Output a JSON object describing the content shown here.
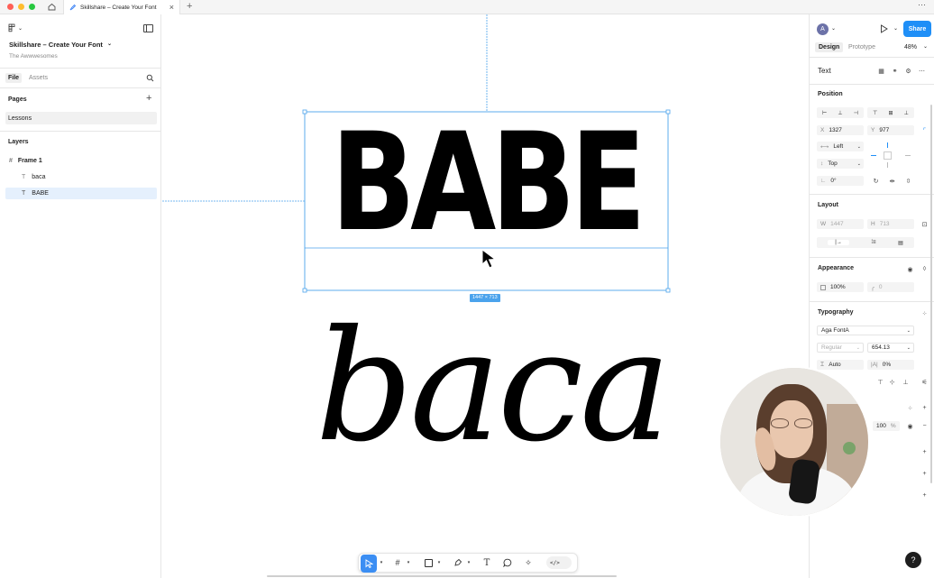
{
  "tabbar": {
    "tab_title": "Skillshare – Create Your Font"
  },
  "left": {
    "file_name": "Skillshare – Create Your Font",
    "team": "The Awwwesomes",
    "tabs": [
      "File",
      "Assets"
    ],
    "pages_label": "Pages",
    "pages": [
      "Lessons"
    ],
    "layers_label": "Layers",
    "layers": [
      "Frame 1",
      "baca",
      "BABE"
    ]
  },
  "canvas": {
    "text_babe": "BABE",
    "text_baca": "baca",
    "size_badge": "1447 × 713"
  },
  "right": {
    "avatar": "A",
    "share": "Share",
    "tabs": [
      "Design",
      "Prototype"
    ],
    "zoom": "48%",
    "layer_type": "Text",
    "position_label": "Position",
    "x_label": "X",
    "x_value": "1327",
    "y_label": "Y",
    "y_value": "977",
    "h_constraint": "Left",
    "v_constraint": "Top",
    "rotation": "0°",
    "layout_label": "Layout",
    "w_label": "W",
    "w_value": "1447",
    "h_label": "H",
    "h_value": "713",
    "appearance_label": "Appearance",
    "opacity": "100%",
    "radius": "0",
    "typography_label": "Typography",
    "font_family": "Aga FontA",
    "font_weight": "Regular",
    "font_size": "654.13",
    "line_height": "Auto",
    "letter_spacing": "0%",
    "fill_opacity": "100",
    "fill_unit": "%"
  },
  "help": "?"
}
